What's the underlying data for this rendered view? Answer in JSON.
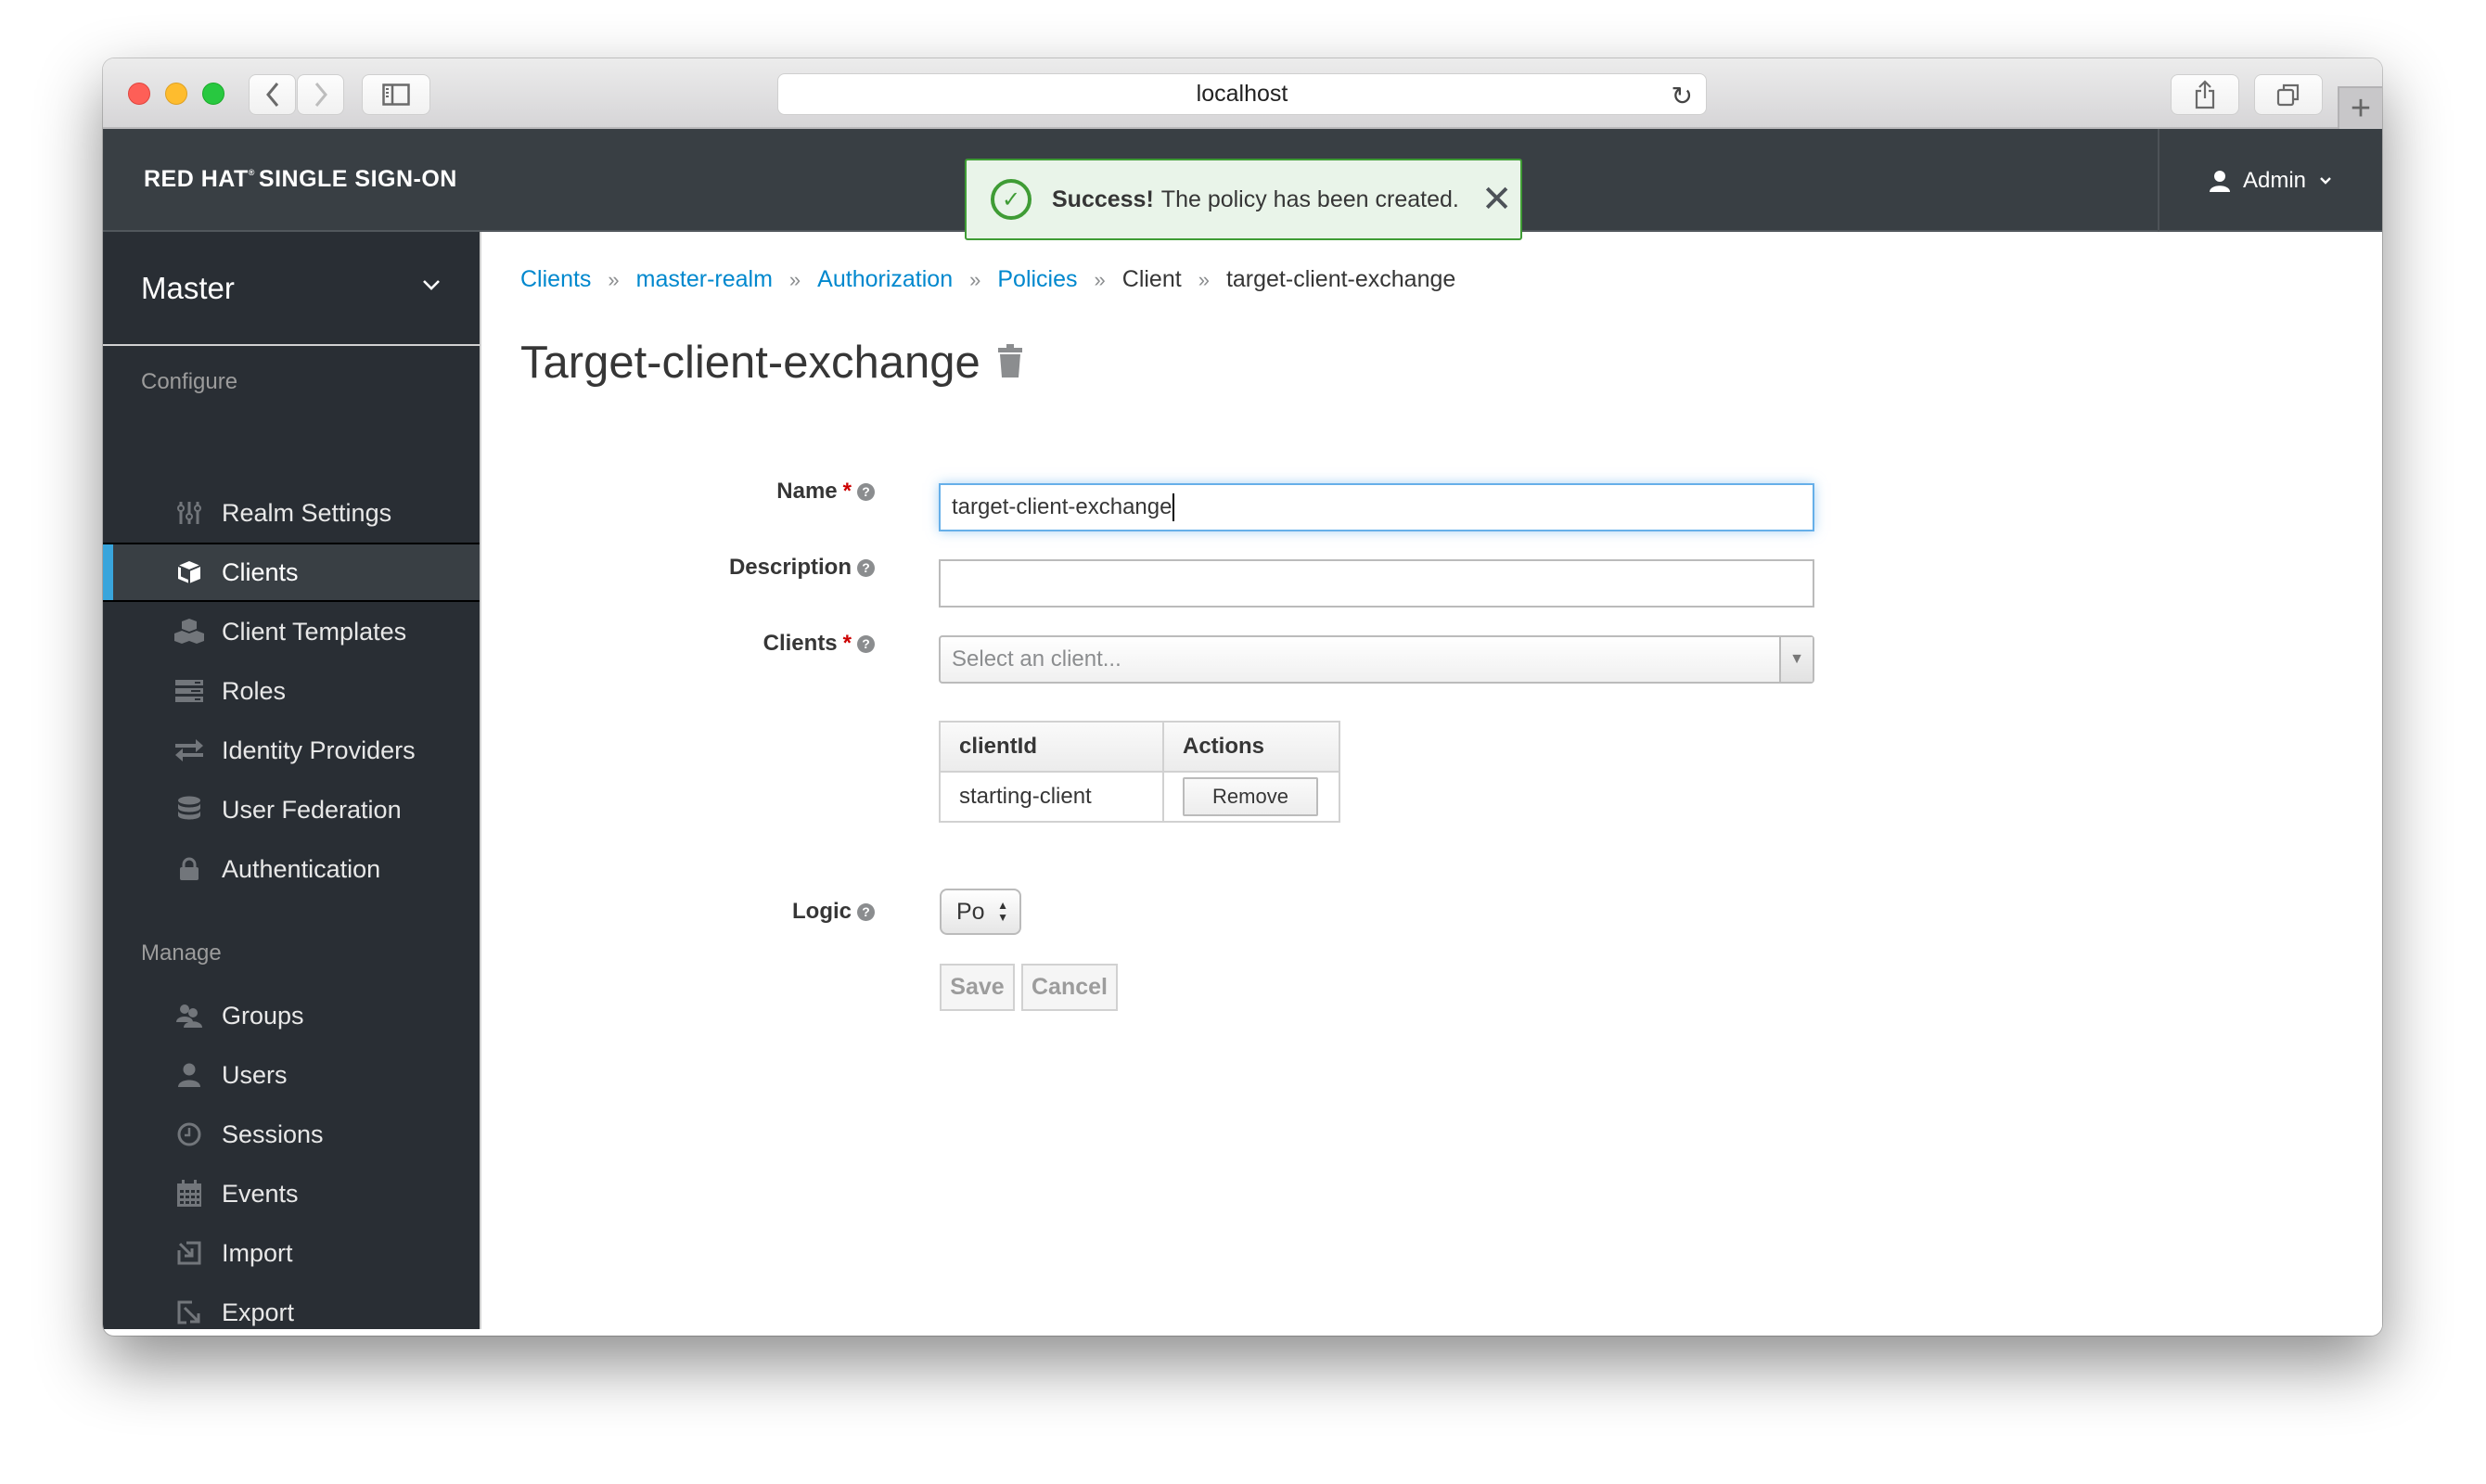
{
  "browser": {
    "url": "localhost",
    "traffic_lights": {
      "close": "#fe5f57",
      "minimize": "#febc2e",
      "zoom": "#28c840"
    }
  },
  "header": {
    "brand_bold": "RED HAT",
    "brand_reg": "®",
    "brand_rest": "SINGLE SIGN-ON",
    "user_label": "Admin"
  },
  "toast": {
    "strong": "Success!",
    "message": "The policy has been created.",
    "close_glyph": "✕",
    "color": "#3f9c35"
  },
  "sidebar": {
    "realm": "Master",
    "sections": [
      {
        "heading": "Configure",
        "items": [
          {
            "label": "Realm Settings",
            "icon": "sliders-icon",
            "active": false
          },
          {
            "label": "Clients",
            "icon": "cube-icon",
            "active": true
          },
          {
            "label": "Client Templates",
            "icon": "cubes-icon",
            "active": false
          },
          {
            "label": "Roles",
            "icon": "server-icon",
            "active": false
          },
          {
            "label": "Identity Providers",
            "icon": "exchange-icon",
            "active": false
          },
          {
            "label": "User Federation",
            "icon": "database-icon",
            "active": false
          },
          {
            "label": "Authentication",
            "icon": "lock-icon",
            "active": false
          }
        ]
      },
      {
        "heading": "Manage",
        "items": [
          {
            "label": "Groups",
            "icon": "users-icon",
            "active": false
          },
          {
            "label": "Users",
            "icon": "user-icon",
            "active": false
          },
          {
            "label": "Sessions",
            "icon": "clock-icon",
            "active": false
          },
          {
            "label": "Events",
            "icon": "calendar-icon",
            "active": false
          },
          {
            "label": "Import",
            "icon": "import-icon",
            "active": false
          },
          {
            "label": "Export",
            "icon": "export-icon",
            "active": false
          }
        ]
      }
    ],
    "accent": "#39a5dc"
  },
  "breadcrumb": [
    {
      "label": "Clients",
      "link": true
    },
    {
      "label": "master-realm",
      "link": true
    },
    {
      "label": "Authorization",
      "link": true
    },
    {
      "label": "Policies",
      "link": true
    },
    {
      "label": "Client",
      "link": false
    },
    {
      "label": "target-client-exchange",
      "link": false
    }
  ],
  "breadcrumb_sep": "»",
  "page": {
    "title": "Target-client-exchange"
  },
  "form": {
    "name": {
      "label": "Name",
      "required": true,
      "value": "target-client-exchange"
    },
    "description": {
      "label": "Description",
      "required": false,
      "value": ""
    },
    "clients": {
      "label": "Clients",
      "required": true,
      "placeholder": "Select an client..."
    },
    "clients_table": {
      "columns": [
        "clientId",
        "Actions"
      ],
      "rows": [
        {
          "clientId": "starting-client",
          "action": "Remove"
        }
      ]
    },
    "logic": {
      "label": "Logic",
      "value": "Po"
    },
    "save_label": "Save",
    "cancel_label": "Cancel",
    "required_mark": "*",
    "help_glyph": "?"
  }
}
